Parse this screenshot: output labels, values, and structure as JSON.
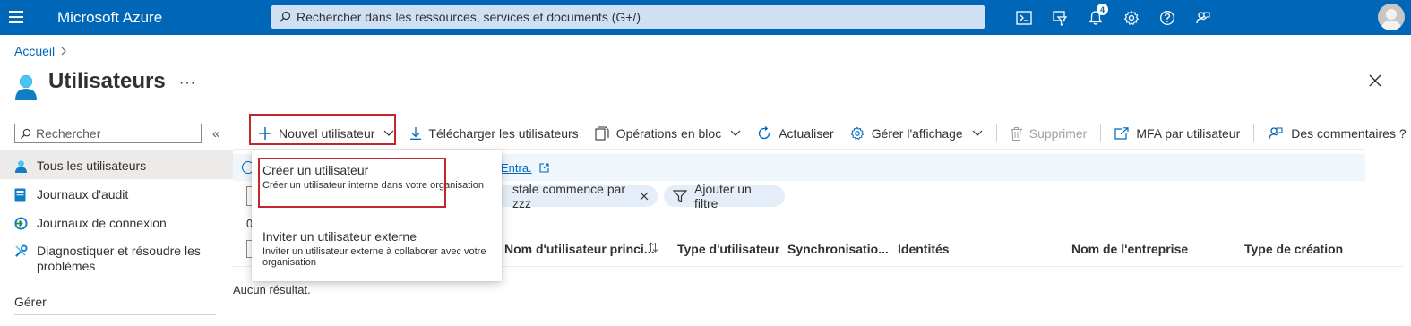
{
  "header": {
    "brand": "Microsoft Azure",
    "search_placeholder": "Rechercher dans les ressources, services et documents (G+/)",
    "notification_count": "4"
  },
  "breadcrumb": {
    "home": "Accueil"
  },
  "page": {
    "title": "Utilisateurs",
    "more": "···"
  },
  "sidebar": {
    "search_placeholder": "Rechercher",
    "items": [
      {
        "label": "Tous les utilisateurs",
        "icon": "user-icon",
        "active": true
      },
      {
        "label": "Journaux d'audit",
        "icon": "audit-log-icon"
      },
      {
        "label": "Journaux de connexion",
        "icon": "sign-in-log-icon"
      },
      {
        "label": "Diagnostiquer et résoudre les problèmes",
        "icon": "wrench-icon"
      }
    ],
    "section": "Gérer"
  },
  "toolbar": {
    "new_user": "Nouvel utilisateur",
    "download": "Télécharger les utilisateurs",
    "bulk": "Opérations en bloc",
    "refresh": "Actualiser",
    "manage_view": "Gérer l'affichage",
    "delete": "Supprimer",
    "mfa": "MFA par utilisateur",
    "feedback": "Des commentaires ?"
  },
  "banner": {
    "link": "Entra."
  },
  "filters": {
    "active_filter": "stale commence par zzz",
    "add_filter": "Ajouter un filtre"
  },
  "count_text": "0",
  "table": {
    "columns": [
      "Nom d'utilisateur princi...",
      "Type d'utilisateur",
      "Synchronisatio...",
      "Identités",
      "Nom de l'entreprise",
      "Type de création"
    ],
    "empty": "Aucun résultat."
  },
  "dropdown": {
    "items": [
      {
        "title": "Créer un utilisateur",
        "description": "Créer un utilisateur interne dans votre organisation"
      },
      {
        "title": "Inviter un utilisateur externe",
        "description": "Inviter un utilisateur externe à collaborer avec votre organisation"
      }
    ]
  },
  "colors": {
    "header_bg": "#0067b8",
    "highlight": "#c4262e",
    "link": "#0067b8"
  }
}
